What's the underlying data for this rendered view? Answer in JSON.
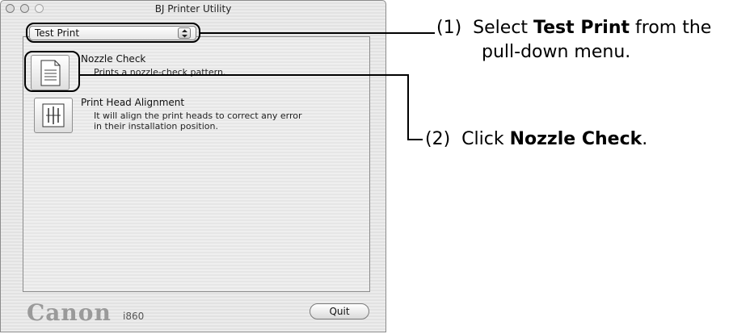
{
  "window": {
    "title": "BJ Printer Utility",
    "popup_value": "Test Print",
    "items": [
      {
        "title": "Nozzle Check",
        "desc_lines": [
          "Prints a nozzle-check pattern."
        ],
        "icon": "document-icon"
      },
      {
        "title": "Print Head Alignment",
        "desc_lines": [
          "It will align the print heads to correct any error",
          "in their installation position."
        ],
        "icon": "print-head-icon"
      }
    ],
    "brand": "Canon",
    "model": "i860",
    "quit_label": "Quit"
  },
  "annotations": {
    "step1": {
      "number": "(1)",
      "pre": "Select ",
      "bold": "Test Print",
      "post": " from the",
      "line2": "pull-down menu."
    },
    "step2": {
      "number": "(2)",
      "pre": "Click ",
      "bold": "Nozzle Check",
      "post": "."
    }
  },
  "colors": {
    "window_stripe_light": "#ececec",
    "window_stripe_dark": "#e2e2e2",
    "brand_gray": "#9a9a9a",
    "annotation": "#000000"
  }
}
